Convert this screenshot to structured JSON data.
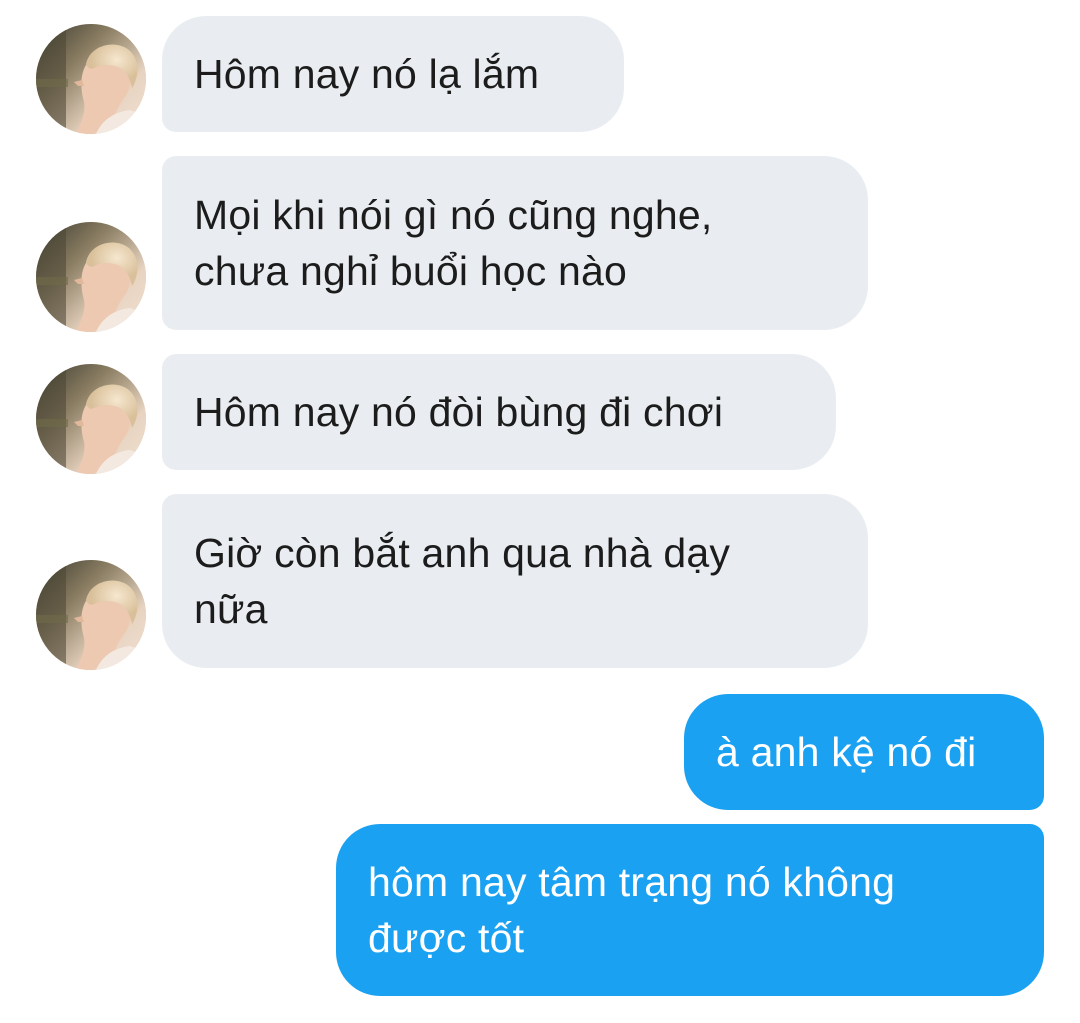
{
  "conversation": {
    "messages": [
      {
        "direction": "incoming",
        "text": "Hôm nay nó lạ lắm"
      },
      {
        "direction": "incoming",
        "text": "Mọi khi nói gì nó cũng nghe,\nchưa nghỉ buổi học nào"
      },
      {
        "direction": "incoming",
        "text": "Hôm nay nó đòi bùng đi chơi"
      },
      {
        "direction": "incoming",
        "text": "Giờ còn bắt anh qua nhà dạy\nnữa"
      },
      {
        "direction": "outgoing",
        "text": "à anh kệ nó đi"
      },
      {
        "direction": "outgoing",
        "text": "hôm nay tâm trạng nó không\nđược tốt"
      }
    ]
  },
  "colors": {
    "incoming_bubble": "#e9edf1",
    "outgoing_bubble": "#1ba1f2",
    "incoming_text": "#1c1c1c",
    "outgoing_text": "#ffffff",
    "background": "#ffffff"
  },
  "icons": {
    "avatar": "contact-avatar-photo"
  }
}
